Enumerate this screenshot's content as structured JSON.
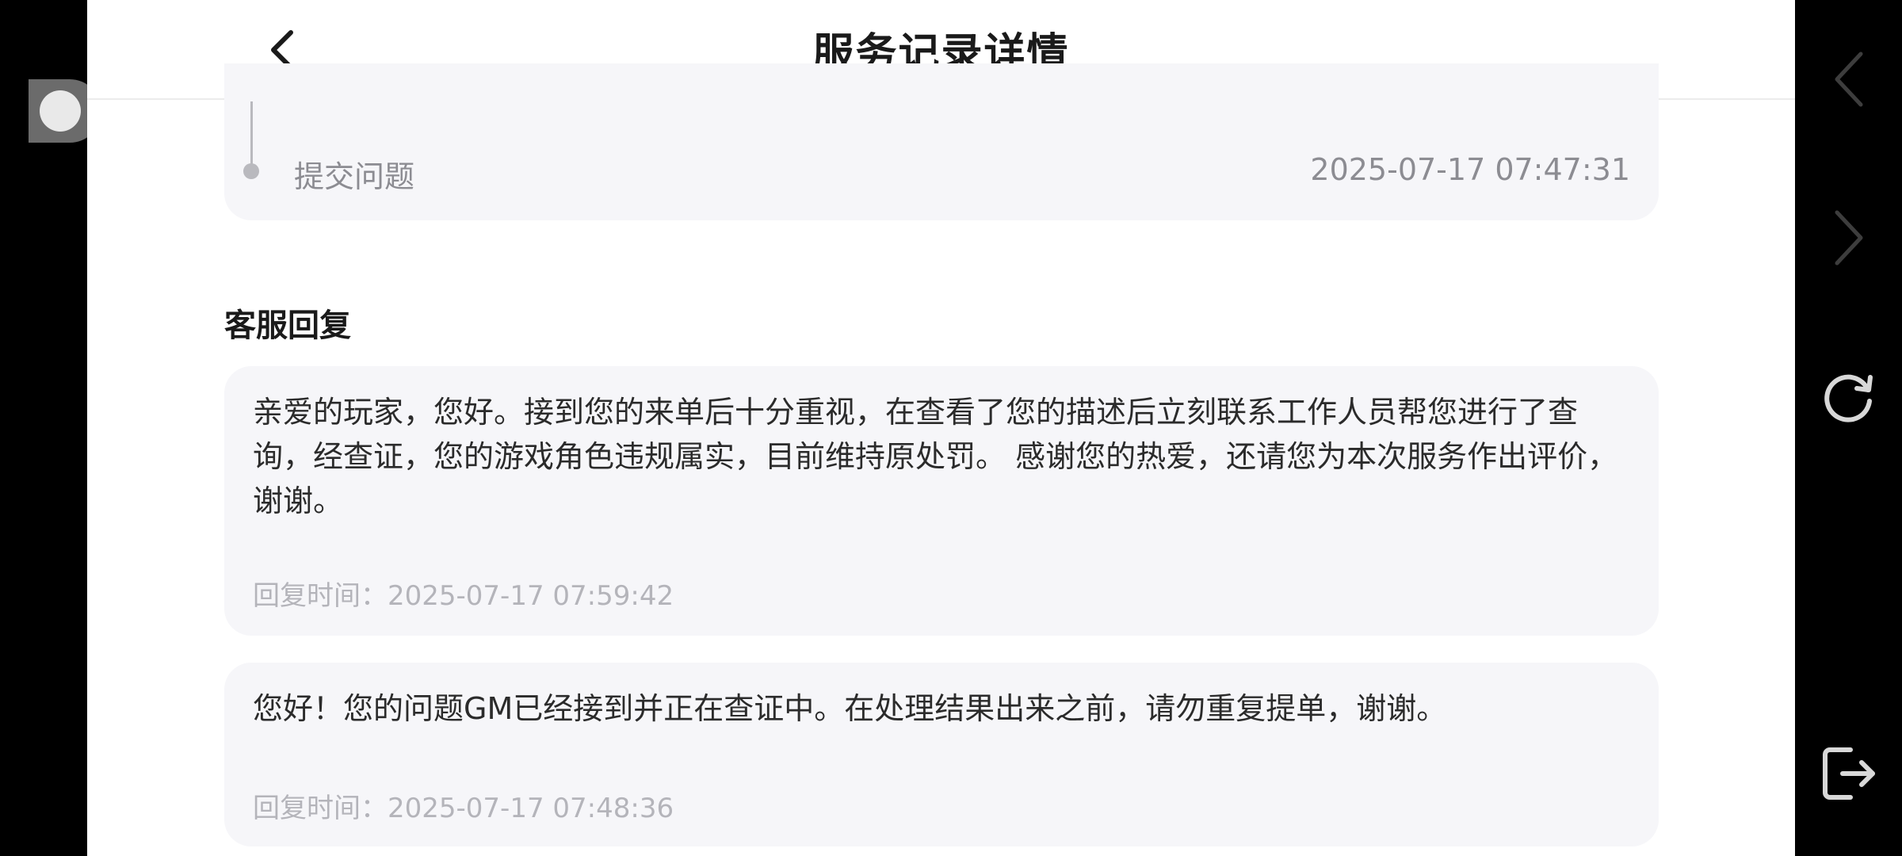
{
  "header": {
    "title": "服务记录详情",
    "back_icon": "chevron-left-icon"
  },
  "timeline": {
    "label": "提交问题",
    "time": "2025-07-17 07:47:31"
  },
  "replies_section": {
    "title": "客服回复",
    "items": [
      {
        "text": "亲爱的玩家，您好。接到您的来单后十分重视，在查看了您的描述后立刻联系工作人员帮您进行了查询，经查证，您的游戏角色违规属实，目前维持原处罚。 感谢您的热爱，还请您为本次服务作出评价，谢谢。",
        "time_label": "回复时间：2025-07-17 07:59:42"
      },
      {
        "text": "您好！您的问题GM已经接到并正在查证中。在处理结果出来之前，请勿重复提单，谢谢。",
        "time_label": "回复时间：2025-07-17 07:48:36"
      }
    ]
  },
  "right_rail": {
    "icons": [
      "chevron-left-icon",
      "chevron-right-icon",
      "refresh-icon",
      "exit-icon"
    ]
  },
  "colors": {
    "card_background": "#f6f6f9",
    "primary_text": "#1a1a1a",
    "secondary_text": "#8c8c92",
    "muted_text": "#b4b4ba"
  }
}
